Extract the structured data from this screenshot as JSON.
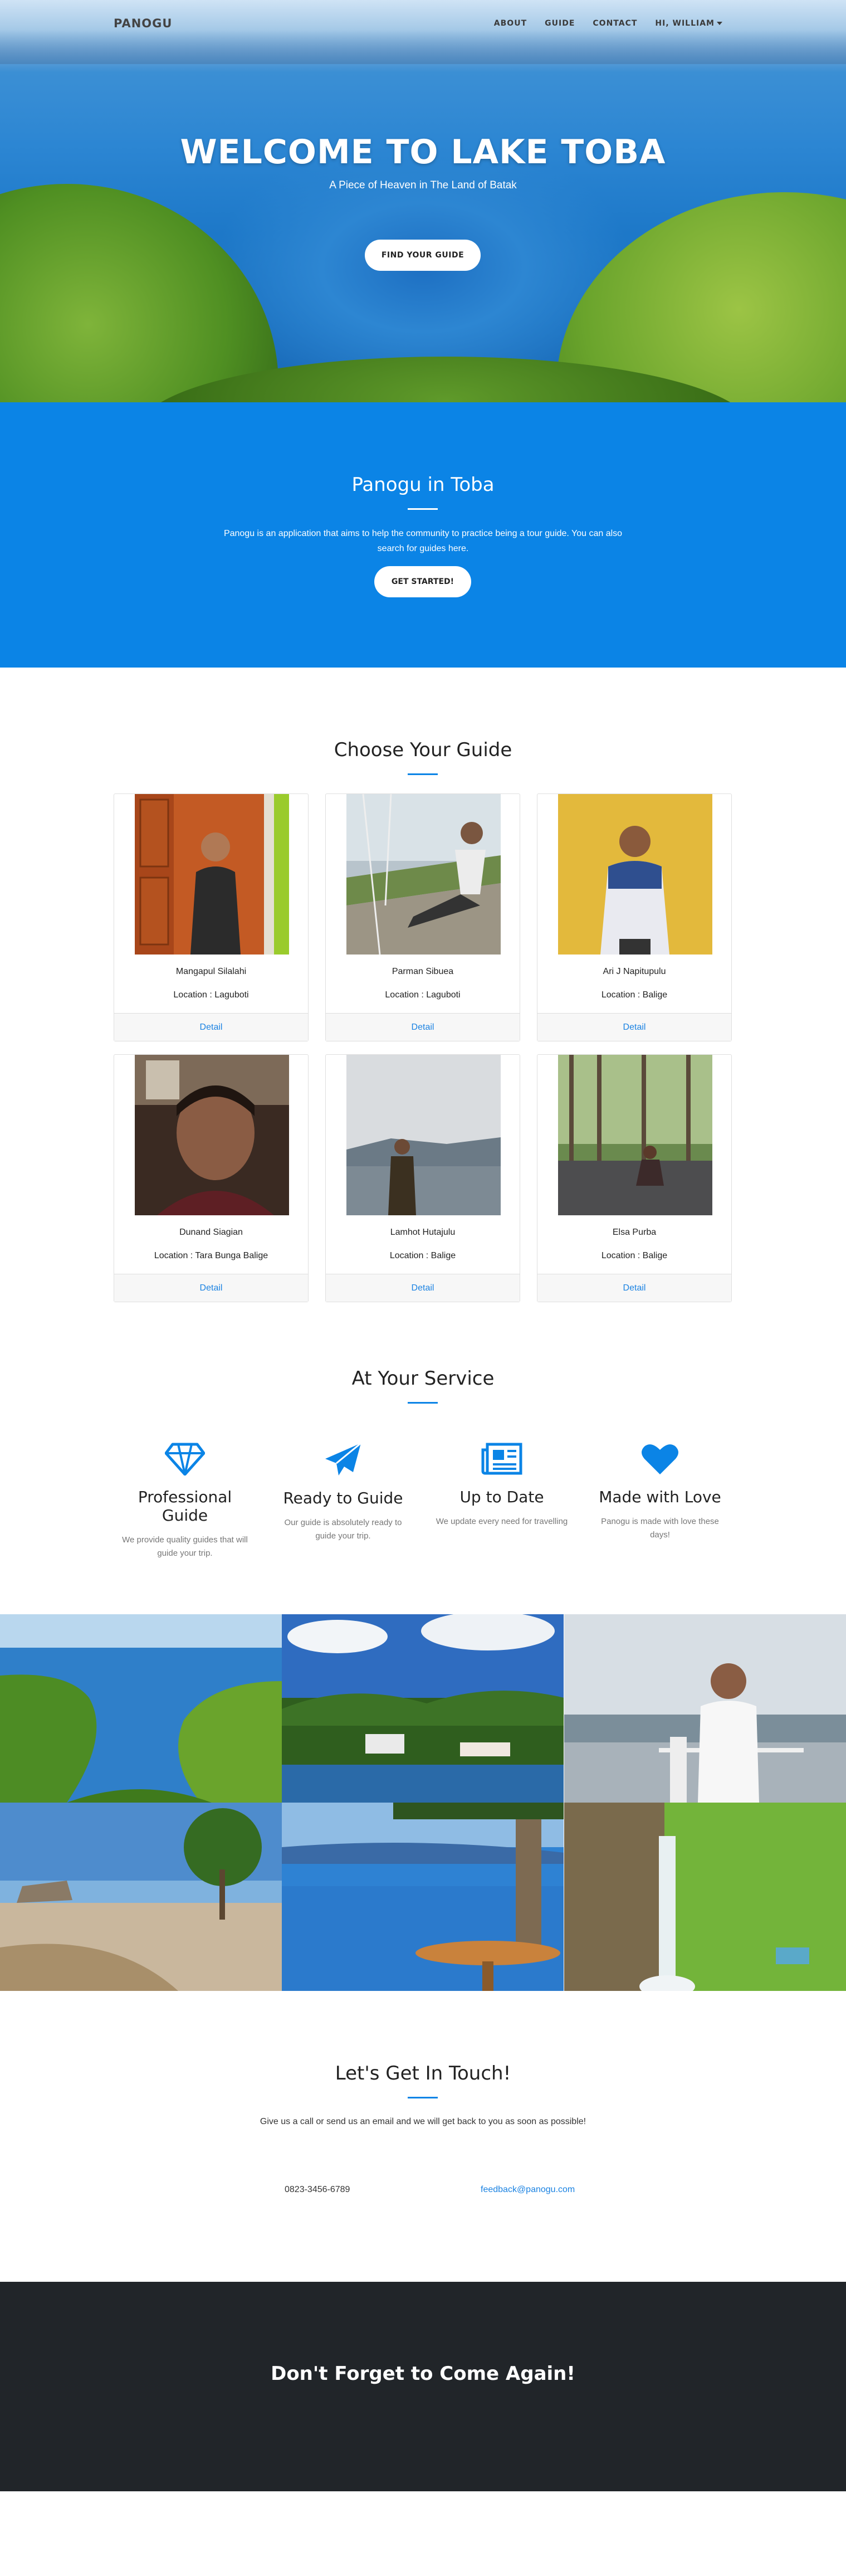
{
  "nav": {
    "brand": "PANOGU",
    "links": [
      "ABOUT",
      "GUIDE",
      "CONTACT"
    ],
    "user": "HI, WILLIAM"
  },
  "hero": {
    "title": "WELCOME TO LAKE TOBA",
    "subtitle": "A Piece of Heaven in The Land of Batak",
    "button": "FIND YOUR GUIDE"
  },
  "about": {
    "title": "Panogu in Toba",
    "text": "Panogu is an application that aims to help the community to practice being a tour guide. You can also search for guides here.",
    "button": "GET STARTED!"
  },
  "guides": {
    "title": "Choose Your Guide",
    "detail_label": "Detail",
    "items": [
      {
        "name": "Mangapul Silalahi",
        "location": "Location : Laguboti"
      },
      {
        "name": "Parman Sibuea",
        "location": "Location : Laguboti"
      },
      {
        "name": "Ari J Napitupulu",
        "location": "Location : Balige"
      },
      {
        "name": "Dunand Siagian",
        "location": "Location : Tara Bunga Balige"
      },
      {
        "name": "Lamhot Hutajulu",
        "location": "Location : Balige"
      },
      {
        "name": "Elsa Purba",
        "location": "Location : Balige"
      }
    ]
  },
  "service": {
    "title": "At Your Service",
    "features": [
      {
        "icon": "diamond-icon",
        "title": "Professional Guide",
        "text": "We provide quality guides that will guide your trip."
      },
      {
        "icon": "paper-plane-icon",
        "title": "Ready to Guide",
        "text": "Our guide is absolutely ready to guide your trip."
      },
      {
        "icon": "newspaper-icon",
        "title": "Up to Date",
        "text": "We update every need for travelling"
      },
      {
        "icon": "heart-icon",
        "title": "Made with Love",
        "text": "Panogu is made with love these days!"
      }
    ]
  },
  "contact": {
    "title": "Let's Get In Touch!",
    "text": "Give us a call or send us an email and we will get back to you as soon as possible!",
    "phone": "0823-3456-6789",
    "email": "feedback@panogu.com"
  },
  "footer": {
    "title": "Don't Forget to Come Again!"
  },
  "colors": {
    "accent": "#0b84e6",
    "link": "#1a82e2",
    "footer_bg": "#212529"
  }
}
